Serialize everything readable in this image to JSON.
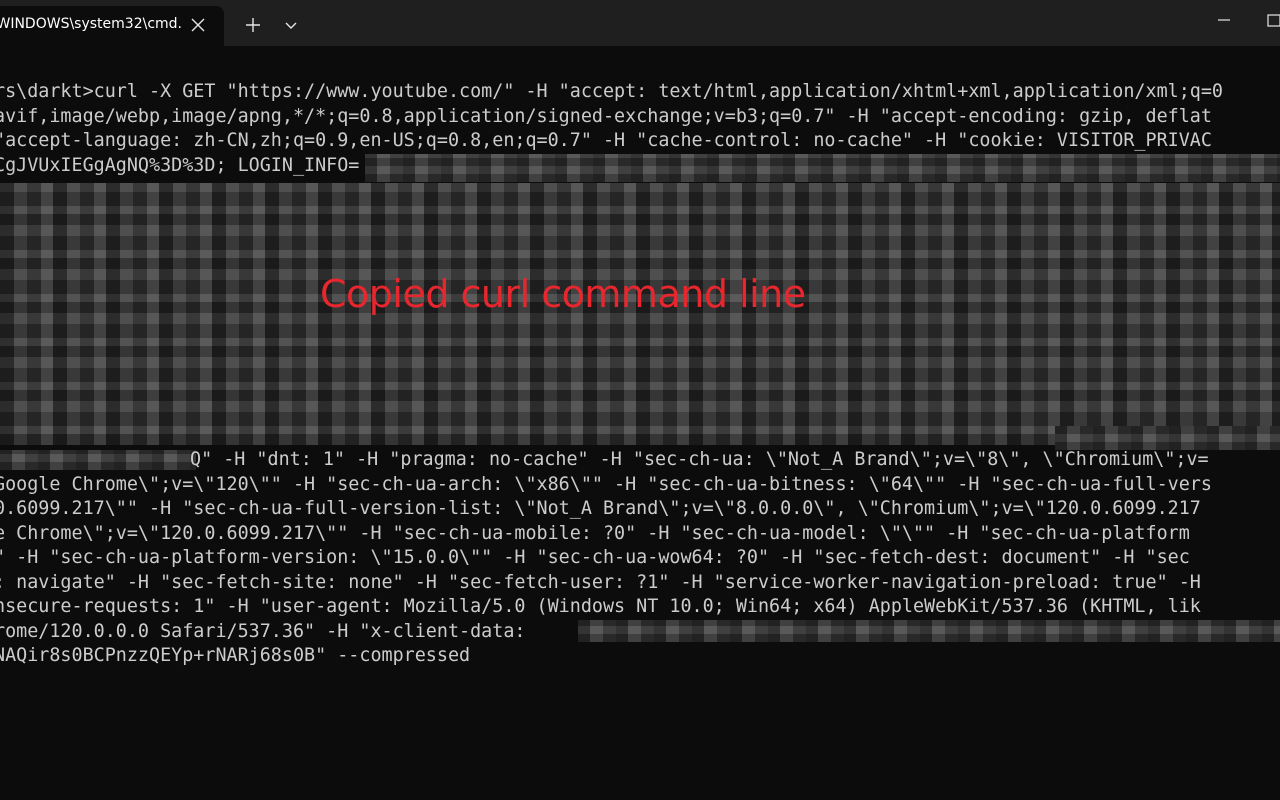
{
  "window": {
    "tab_title": "C:\\WINDOWS\\system32\\cmd.",
    "close_glyph": "✕",
    "new_tab_glyph": "+",
    "dropdown_glyph": "⌄",
    "minimize_glyph": "—",
    "maximize_glyph": "☐"
  },
  "terminal": {
    "lines": [
      "rs\\darkt>curl -X GET \"https://www.youtube.com/\" -H \"accept: text/html,application/xhtml+xml,application/xml;q=0",
      "avif,image/webp,image/apng,*/*;q=0.8,application/signed-exchange;v=b3;q=0.7\" -H \"accept-encoding: gzip, deflat",
      "\"accept-language: zh-CN,zh;q=0.9,en-US;q=0.8,en;q=0.7\" -H \"cache-control: no-cache\" -H \"cookie: VISITOR_PRIVAC",
      "CgJVUxIEGgAgNQ%3D%3D; LOGIN_INFO=",
      "Q\" -H \"dnt: 1\" -H \"pragma: no-cache\" -H \"sec-ch-ua: \\\"Not_A Brand\\\";v=\\\"8\\\", \\\"Chromium\\\";v=",
      "Google Chrome\\\";v=\\\"120\\\"\" -H \"sec-ch-ua-arch: \\\"x86\\\"\" -H \"sec-ch-ua-bitness: \\\"64\\\"\" -H \"sec-ch-ua-full-vers",
      "0.6099.217\\\"\" -H \"sec-ch-ua-full-version-list: \\\"Not_A Brand\\\";v=\\\"8.0.0.0\\\", \\\"Chromium\\\";v=\\\"120.0.6099.217",
      "e Chrome\\\";v=\\\"120.0.6099.217\\\"\" -H \"sec-ch-ua-mobile: ?0\" -H \"sec-ch-ua-model: \\\"\\\"\" -H \"sec-ch-ua-platform",
      "\" -H \"sec-ch-ua-platform-version: \\\"15.0.0\\\"\" -H \"sec-ch-ua-wow64: ?0\" -H \"sec-fetch-dest: document\" -H \"sec",
      ": navigate\" -H \"sec-fetch-site: none\" -H \"sec-fetch-user: ?1\" -H \"service-worker-navigation-preload: true\" -H",
      "nsecure-requests: 1\" -H \"user-agent: Mozilla/5.0 (Windows NT 10.0; Win64; x64) AppleWebKit/537.36 (KHTML, lik",
      "rome/120.0.0.0 Safari/537.36\" -H \"x-client-data: ",
      "NAQir8s0BCPnzzQEYp+rNARj68s0B\" --compressed"
    ]
  },
  "overlay": {
    "label": "Copied curl command line",
    "color": "#e8262e"
  }
}
